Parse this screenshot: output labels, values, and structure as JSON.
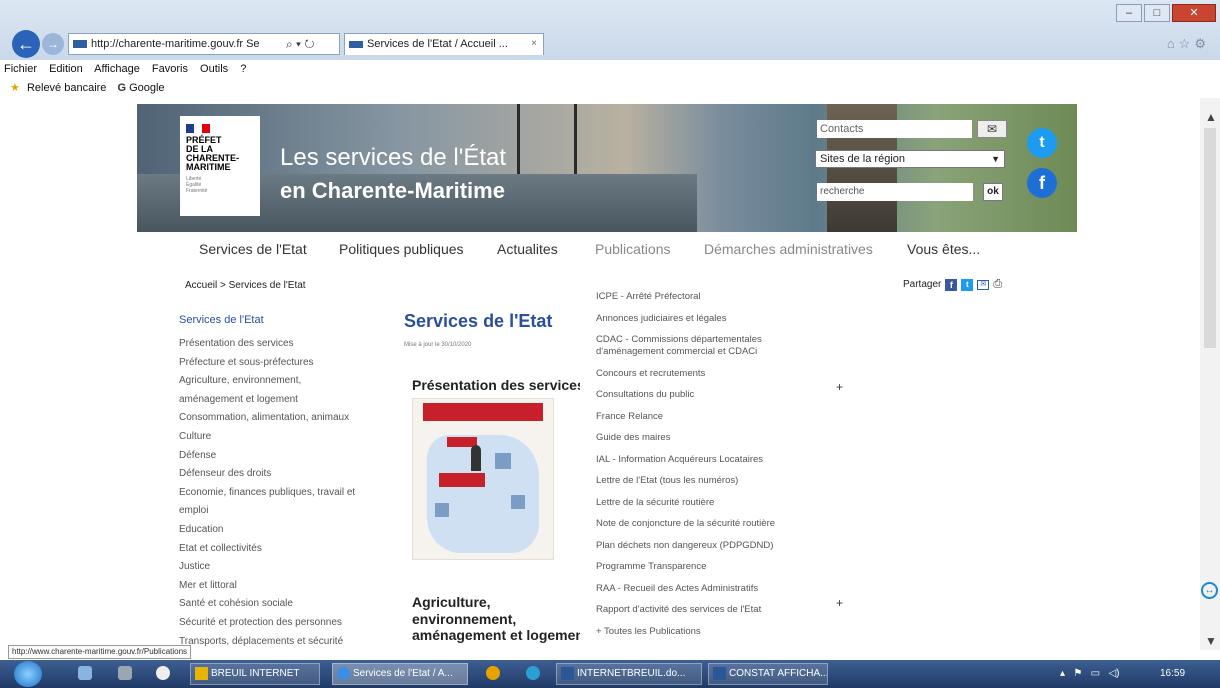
{
  "browser": {
    "address": "http://www.charente-maritime.gouv.fr",
    "address_display_prefix": "http://",
    "address_display_host": "charente-maritime.gouv.fr Se",
    "address_controls": "⌕ ▾ ↻",
    "tab_title": "Services de l'Etat / Accueil ...",
    "tab_close": "×",
    "menu": [
      "Fichier",
      "Edition",
      "Affichage",
      "Favoris",
      "Outils",
      "?"
    ],
    "favorites": [
      "Relevé bancaire",
      "Google"
    ],
    "google_glyph": "G"
  },
  "banner": {
    "logo_text": "PRÉFET\nDE LA\nCHARENTE-\nMARITIME",
    "logo_motto": "Liberté\nÉgalité\nFraternité",
    "title_line1": "Les services de l'État",
    "title_line2": "en Charente-Maritime",
    "contacts_placeholder": "Contacts",
    "region_select": "Sites de la région",
    "search_placeholder": "recherche",
    "ok_label": "ok"
  },
  "mainnav": [
    "Services de l'Etat",
    "Politiques publiques",
    "Actualites",
    "Publications",
    "Démarches administratives",
    "Vous êtes..."
  ],
  "breadcrumb": "Accueil > Services de l'Etat",
  "share_label": "Partager",
  "sidebar": {
    "title": "Services de l'Etat",
    "items": [
      "Présentation des services",
      "Préfecture et sous-préfectures",
      "Agriculture, environnement,",
      "aménagement et logement",
      "Consommation, alimentation, animaux",
      "Culture",
      "Défense",
      "Défenseur des droits",
      "Economie, finances publiques, travail et",
      "emploi",
      "Education",
      "Etat et collectivités",
      "Justice",
      "Mer et littoral",
      "Santé et cohésion sociale",
      "Sécurité et protection des personnes",
      "Transports, déplacements et sécurité"
    ]
  },
  "center": {
    "title": "Services de l'Etat",
    "date": "Mise à jour le 30/10/2020",
    "pres_title": "Présentation des services",
    "agri_title_1": "Agriculture,",
    "agri_title_2": "environnement,",
    "agri_title_3": "aménagement et logement"
  },
  "right_list": [
    "ICPE - Arrêté Préfectoral",
    "Annonces judiciaires et légales",
    "CDAC - Commissions départementales d'aménagement commercial et CDACi",
    "Concours et recrutements",
    "Consultations du public",
    "France Relance",
    "Guide des maires",
    "IAL - Information Acquéreurs Locataires",
    "Lettre de l'Etat (tous les numéros)",
    "Lettre de la sécurité routière",
    "Note de conjoncture de la sécurité routière",
    "Plan déchets non dangereux (PDPGDND)",
    "Programme Transparence",
    "RAA - Recueil des Actes Administratifs",
    "Rapport d'activité des services de l'Etat",
    "+ Toutes les Publications"
  ],
  "status_url": "http://www.charente-maritime.gouv.fr/Publications",
  "taskbar": {
    "items": [
      "BREUIL INTERNET",
      "Services de l'Etat / A...",
      "INTERNETBREUIL.do...",
      "CONSTAT AFFICHA..."
    ],
    "clock": "16:59"
  },
  "colors": {
    "link_blue": "#2a4f9c",
    "taskbar": "#213a66",
    "twitter": "#1d9bf0",
    "facebook": "#1d6fd6"
  }
}
